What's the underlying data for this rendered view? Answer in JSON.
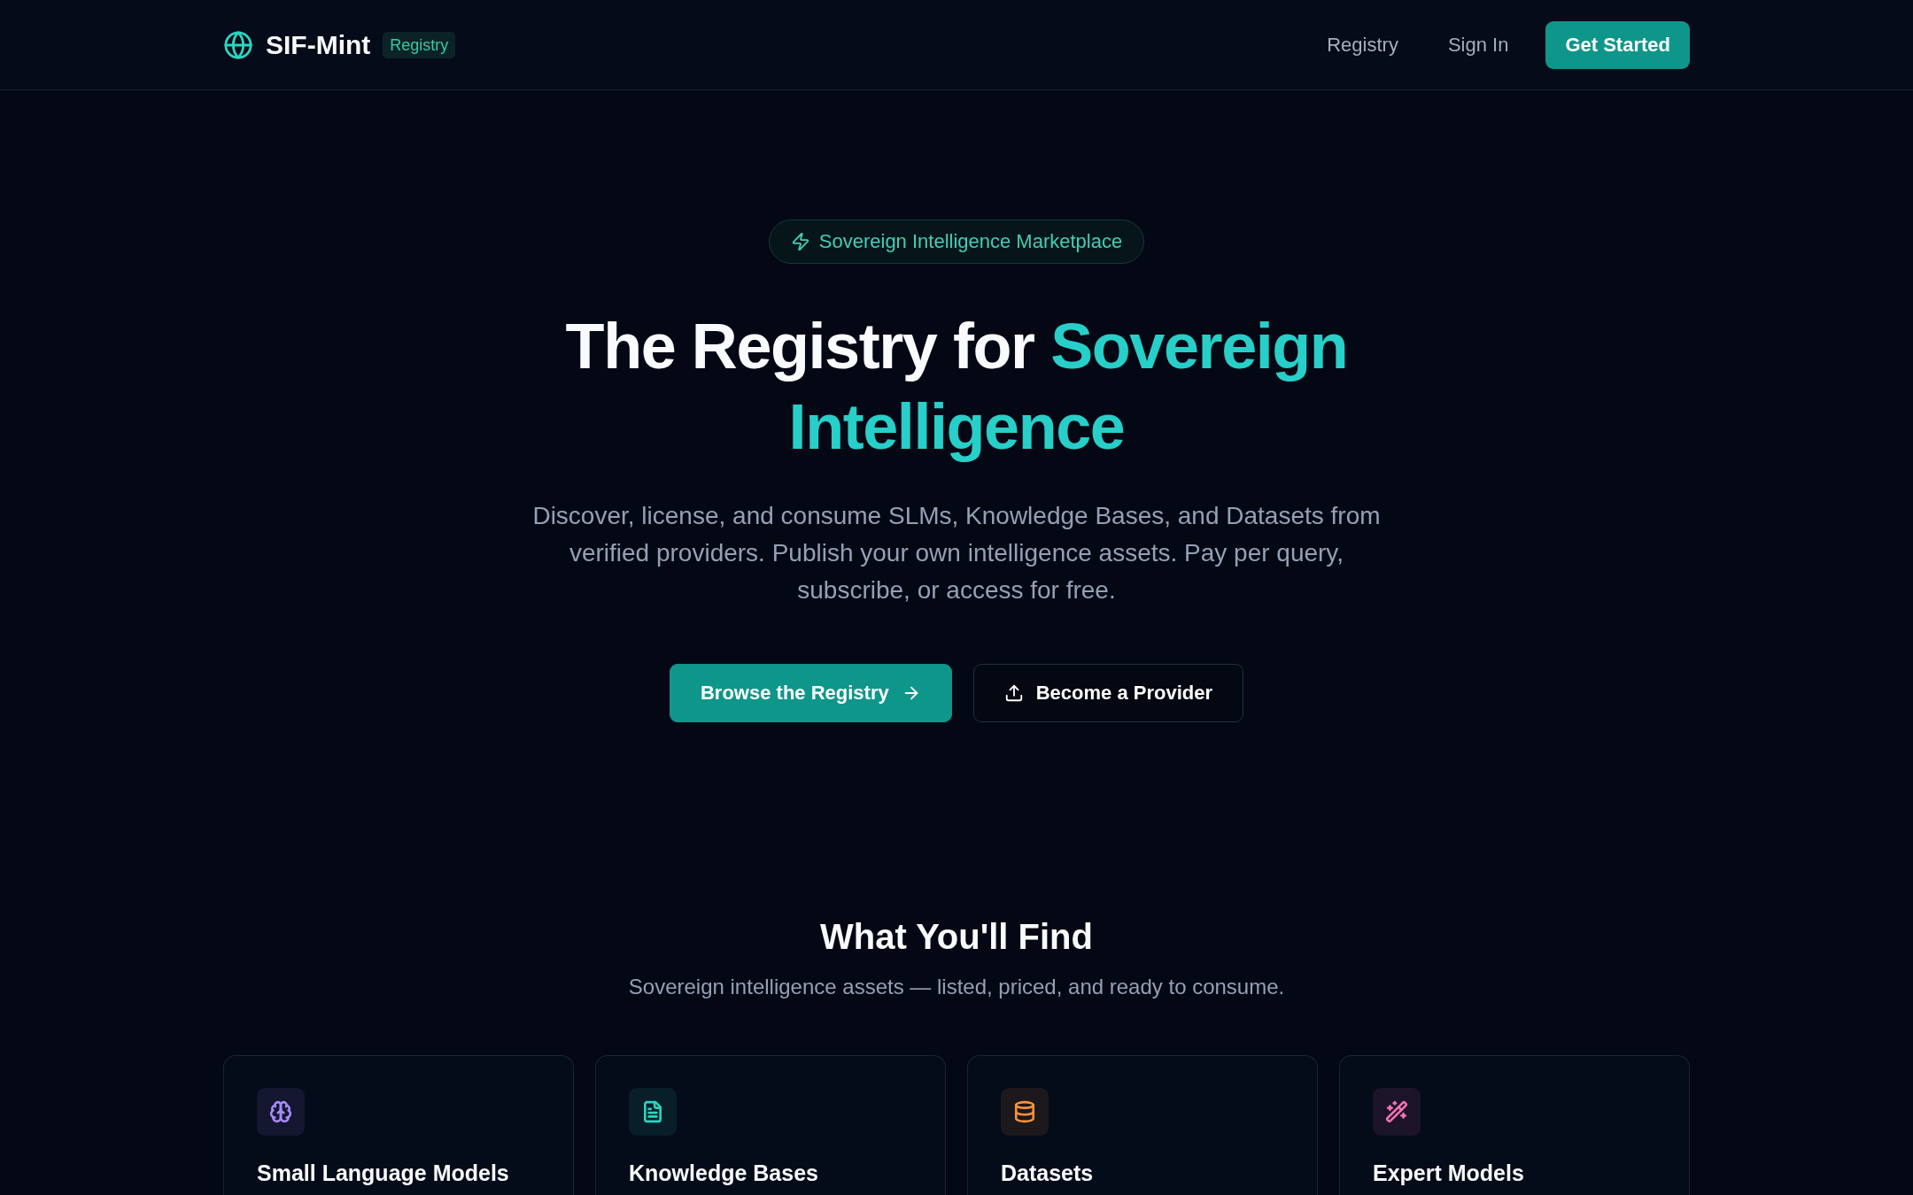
{
  "header": {
    "logo": "SIF-Mint",
    "logo_badge": "Registry",
    "nav_links": [
      "Registry",
      "Sign In"
    ],
    "cta": "Get Started"
  },
  "hero": {
    "badge": "Sovereign Intelligence Marketplace",
    "title_lead": "The Registry for",
    "title_highlight": "Sovereign Intelligence",
    "description": "Discover, license, and consume SLMs, Knowledge Bases, and Datasets from verified providers. Publish your own intelligence assets. Pay per query, subscribe, or access for free.",
    "buttons": [
      {
        "label": "Browse the Registry",
        "kind": "primary"
      },
      {
        "label": "Become a Provider",
        "kind": "secondary"
      }
    ]
  },
  "section": {
    "title": "What You'll Find",
    "subtitle": "Sovereign intelligence assets — listed, priced, and ready to consume.",
    "cards": [
      {
        "title": "Small Language Models",
        "color": "#a78bfa"
      },
      {
        "title": "Knowledge Bases",
        "color": "#2dd4bf"
      },
      {
        "title": "Datasets",
        "color": "#fb923c"
      },
      {
        "title": "Expert Models",
        "color": "#f472b6"
      }
    ]
  }
}
